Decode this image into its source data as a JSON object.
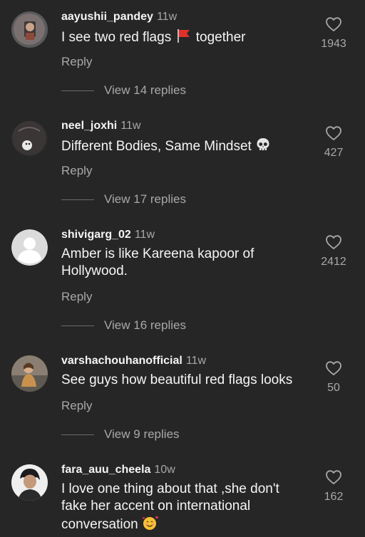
{
  "comments": [
    {
      "username": "aayushii_pandey",
      "time": "11w",
      "text": "I see two red flags",
      "text_after": "together",
      "reply": "Reply",
      "view_replies": "View 14 replies",
      "likes": "1943",
      "avatar_icon": "profile-photo"
    },
    {
      "username": "neel_joxhi",
      "time": "11w",
      "text": "Different Bodies, Same Mindset",
      "reply": "Reply",
      "view_replies": "View 17 replies",
      "likes": "427",
      "avatar_icon": "profile-photo"
    },
    {
      "username": "shivigarg_02",
      "time": "11w",
      "text": "Amber is like Kareena kapoor of Hollywood.",
      "reply": "Reply",
      "view_replies": "View 16 replies",
      "likes": "2412",
      "avatar_icon": "default-avatar-icon"
    },
    {
      "username": "varshachouhanofficial",
      "time": "11w",
      "text": "See guys how beautiful red flags looks",
      "reply": "Reply",
      "view_replies": "View 9 replies",
      "likes": "50",
      "avatar_icon": "profile-photo"
    },
    {
      "username": "fara_auu_cheela",
      "time": "10w",
      "text": "I love one thing about that ,she don't fake her accent on international conversation",
      "likes": "162",
      "avatar_icon": "profile-photo"
    }
  ],
  "colors": {
    "background": "#262626",
    "primary_text": "#f5f5f5",
    "secondary_text": "#a8a8a8"
  }
}
